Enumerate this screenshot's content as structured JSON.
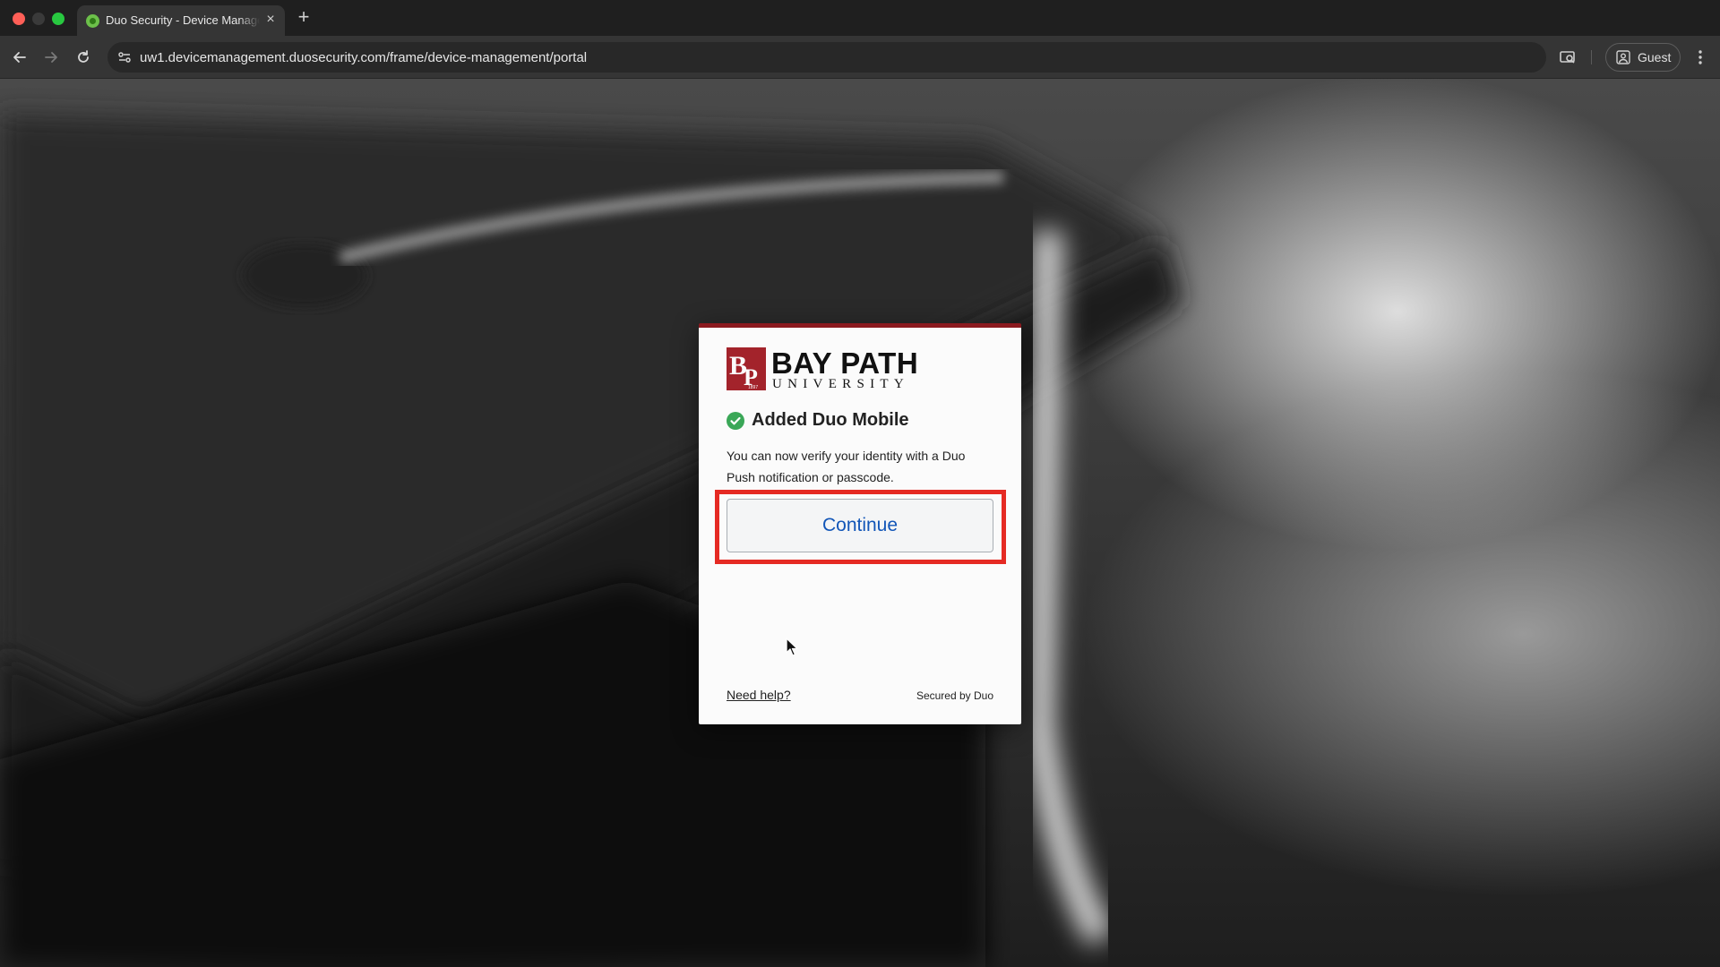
{
  "browser": {
    "tab": {
      "title": "Duo Security - Device Management Portal",
      "favicon": "duo-favicon"
    },
    "address_bar": {
      "url": "uw1.devicemanagement.duosecurity.com/frame/device-management/portal"
    },
    "profile": {
      "label": "Guest"
    },
    "icons": [
      "back-arrow-icon",
      "forward-arrow-icon",
      "reload-icon",
      "site-info-icon",
      "cast-search-icon",
      "person-icon",
      "kebab-menu-icon"
    ]
  },
  "card": {
    "accent_color": "#8b1a1f",
    "logo": {
      "name": "BAY PATH",
      "subtitle": "UNIVERSITY",
      "mark_letters": "BP",
      "mark_year": "1897"
    },
    "status": {
      "icon": "check-circle-icon",
      "title": "Added Duo Mobile",
      "color": "#3aa757"
    },
    "message": "You can now verify your identity with a Duo Push notification or passcode.",
    "continue_label": "Continue",
    "highlight_color": "#e52a23",
    "footer": {
      "help_link": "Need help?",
      "secured_by": "Secured by Duo"
    }
  }
}
